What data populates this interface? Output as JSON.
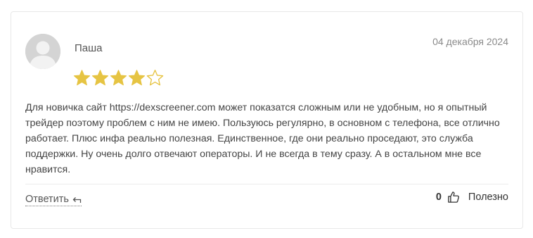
{
  "review": {
    "author": "Паша",
    "date": "04 декабря 2024",
    "rating": 4,
    "max_rating": 5,
    "text": "Для новичка сайт https://dexscreener.com может показатся сложным или не удобным, но я опытный трейдер поэтому проблем с ним не имею. Пользуюсь регулярно, в основном с телефона, все отлично работает. Плюс инфа реально полезная. Единственное, где они реально проседают, это служба поддержки. Ну очень долго отвечают операторы. И не всегда в тему сразу. А в остальном мне все нравится."
  },
  "actions": {
    "reply_label": "Ответить",
    "reply_icon": "reply-arrow-icon",
    "like_count": "0",
    "like_icon": "thumbs-up-icon",
    "useful_label": "Полезно"
  },
  "colors": {
    "star_filled": "#e6c443",
    "star_empty": "#e6c443",
    "avatar_bg": "#d6d6d6"
  }
}
